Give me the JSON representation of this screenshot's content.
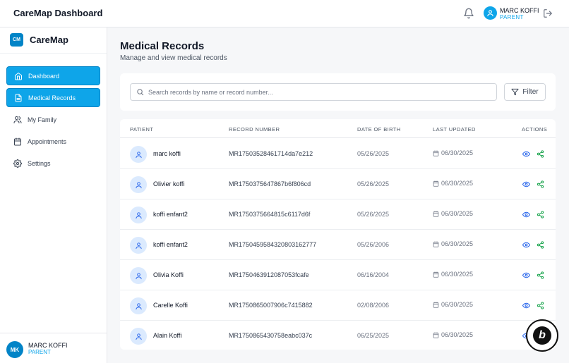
{
  "header": {
    "title": "CareMap Dashboard",
    "user_name": "MARC KOFFI",
    "user_role": "PARENT"
  },
  "sidebar": {
    "brand_logo": "CM",
    "brand_name": "CareMap",
    "items": [
      {
        "label": "Dashboard",
        "icon": "home-icon",
        "active": true
      },
      {
        "label": "Medical Records",
        "icon": "document-icon",
        "active": true
      },
      {
        "label": "My Family",
        "icon": "users-icon",
        "active": false
      },
      {
        "label": "Appointments",
        "icon": "calendar-icon",
        "active": false
      },
      {
        "label": "Settings",
        "icon": "gear-icon",
        "active": false
      }
    ],
    "footer": {
      "initials": "MK",
      "name": "MARC KOFFI",
      "role": "PARENT"
    }
  },
  "main": {
    "title": "Medical Records",
    "subtitle": "Manage and view medical records",
    "search": {
      "placeholder": "Search records by name or record number...",
      "value": ""
    },
    "filter_label": "Filter"
  },
  "table": {
    "columns": [
      "PATIENT",
      "RECORD NUMBER",
      "DATE OF BIRTH",
      "LAST UPDATED",
      "ACTIONS"
    ],
    "rows": [
      {
        "patient": "marc koffi",
        "record": "MR17503528461714da7e212",
        "dob": "05/26/2025",
        "updated": "06/30/2025"
      },
      {
        "patient": "Olivier koffi",
        "record": "MR1750375647867b6f806cd",
        "dob": "05/26/2025",
        "updated": "06/30/2025"
      },
      {
        "patient": "koffi enfant2",
        "record": "MR1750375664815c6117d6f",
        "dob": "05/26/2025",
        "updated": "06/30/2025"
      },
      {
        "patient": "koffi enfant2",
        "record": "MR1750459584320803162777",
        "dob": "05/26/2006",
        "updated": "06/30/2025"
      },
      {
        "patient": "Olivia Koffi",
        "record": "MR1750463912087053fcafe",
        "dob": "06/16/2004",
        "updated": "06/30/2025"
      },
      {
        "patient": "Carelle Koffi",
        "record": "MR1750865007906c7415882",
        "dob": "02/08/2006",
        "updated": "06/30/2025"
      },
      {
        "patient": "Alain Koffi",
        "record": "MR1750865430758eabc037c",
        "dob": "06/25/2025",
        "updated": "06/30/2025"
      }
    ]
  },
  "colors": {
    "accent": "#0ea5e9",
    "accent_dark": "#0284c7",
    "view_icon": "#2563eb",
    "share_icon": "#16a34a"
  }
}
